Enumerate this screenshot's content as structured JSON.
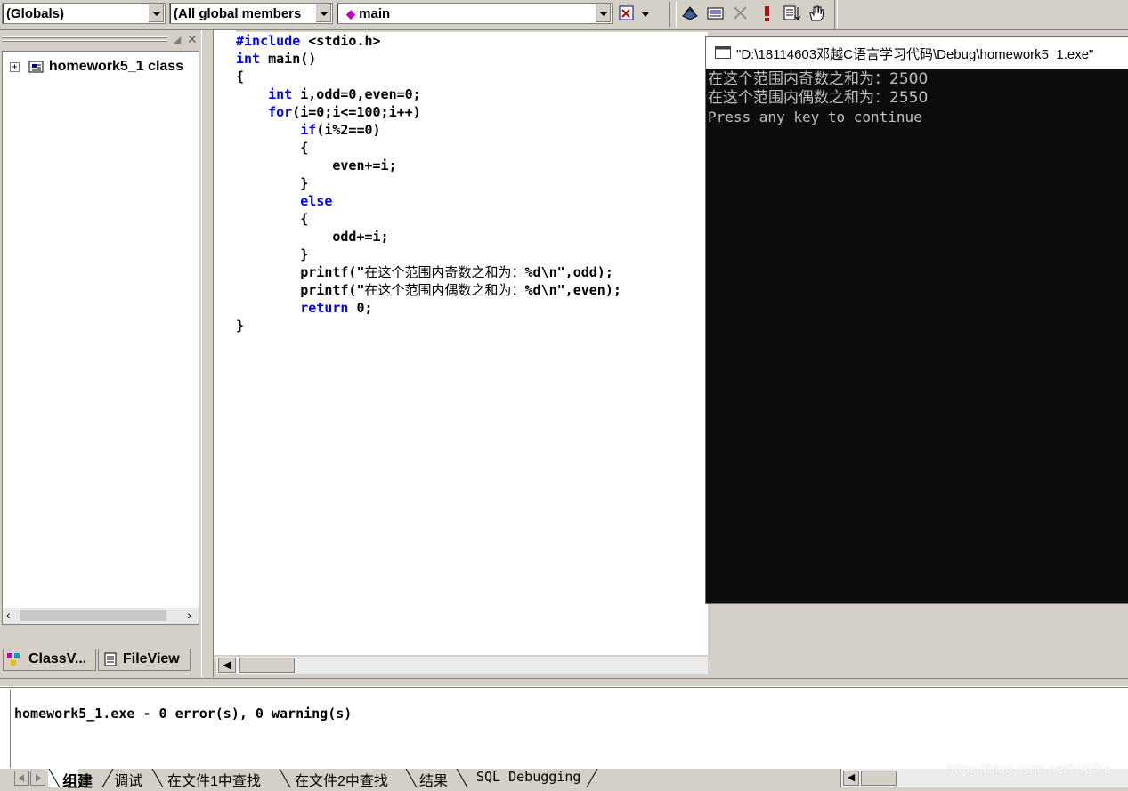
{
  "toolbar": {
    "scope_combo": "(Globals)",
    "filter_combo": "(All global members",
    "function_combo": "main"
  },
  "workspace": {
    "tree_root": "homework5_1 class",
    "tabs": [
      "ClassV...",
      "FileView"
    ]
  },
  "editor": {
    "lines": [
      {
        "kw": "#include",
        "rest": " <stdio.h>"
      },
      {
        "kw": "int",
        "rest": " main()"
      },
      {
        "text": "{"
      },
      {
        "indent": "    ",
        "kw": "int",
        "rest": " i,odd=0,even=0;"
      },
      {
        "indent": "    ",
        "kw": "for",
        "rest": "(i=0;i<=100;i++)"
      },
      {
        "indent": "        ",
        "kw": "if",
        "rest": "(i%2==0)"
      },
      {
        "text": "        {"
      },
      {
        "text": "            even+=i;"
      },
      {
        "text": "        }"
      },
      {
        "indent": "        ",
        "kw": "else",
        "rest": ""
      },
      {
        "text": "        {"
      },
      {
        "text": "            odd+=i;"
      },
      {
        "text": "        }"
      },
      {
        "indent": "        ",
        "pre": "printf(\"",
        "cn": "在这个范围内奇数之和为：",
        "post": "%d\\n\",odd);"
      },
      {
        "indent": "        ",
        "pre": "printf(\"",
        "cn": "在这个范围内偶数之和为：",
        "post": "%d\\n\",even);"
      },
      {
        "indent": "        ",
        "kw": "return",
        "rest": " 0;"
      },
      {
        "text": "}"
      }
    ]
  },
  "console": {
    "title": "\"D:\\18114603邓越C语言学习代码\\Debug\\homework5_1.exe\"",
    "lines": [
      "在这个范围内奇数之和为：2500",
      "在这个范围内偶数之和为：2550",
      "Press any key to continue"
    ]
  },
  "output": {
    "message": "homework5_1.exe - 0 error(s), 0 warning(s)",
    "tabs": [
      "组建",
      "调试",
      "在文件1中查找",
      "在文件2中查找",
      "结果",
      "SQL Debugging"
    ]
  },
  "watermark": "https://blog.csdn.net/Hayika",
  "colors": {
    "keyword": "#0000ff",
    "console_bg": "#0c0c0c",
    "console_text": "#c0c0c0"
  }
}
